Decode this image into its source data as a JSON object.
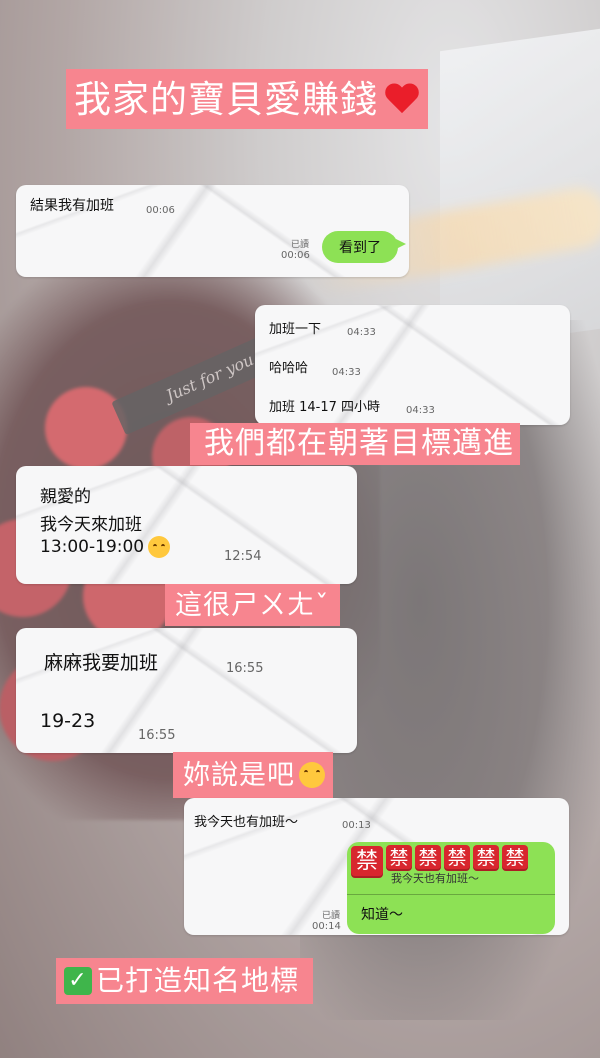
{
  "captions": {
    "title": "我家的寶貝愛賺錢",
    "title_icon": "red-heart-emoji",
    "cap2": "我們都在朝著目標邁進",
    "cap3": "這很ㄕㄨㄤˇ",
    "cap4": "妳說是吧",
    "cap4_icon": "relieved-face-emoji",
    "cap5": "已打造知名地標",
    "cap5_icon": "check-mark-emoji"
  },
  "background": {
    "ribbon_text": "Just for you"
  },
  "chat1": {
    "msg": "結果我有加班",
    "msg_time": "00:06",
    "read_label": "已讀",
    "reply_time": "00:06",
    "reply": "看到了"
  },
  "chat2": {
    "messages": [
      {
        "text": "加班一下",
        "time": "04:33"
      },
      {
        "text": "哈哈哈",
        "time": "04:33"
      },
      {
        "text": "加班 14-17 四小時",
        "time": "04:33"
      }
    ]
  },
  "chat3": {
    "line1": "親愛的",
    "line2": "我今天來加班",
    "line3": "13:00-19:00",
    "emoji": "smiling-face-emoji",
    "time": "12:54"
  },
  "chat4": {
    "msg1": "麻麻我要加班",
    "time1": "16:55",
    "msg2": "19-23",
    "time2": "16:55"
  },
  "chat5": {
    "msg": "我今天也有加班～",
    "msg_time": "00:13",
    "ban_char": "禁",
    "quote": "我今天也有加班～",
    "reply": "知道～",
    "read_label": "已讀",
    "reply_time": "00:14"
  },
  "colors": {
    "caption_bg": "#f7858f",
    "bubble_green": "#8de155",
    "ban_red": "#d8262e"
  }
}
